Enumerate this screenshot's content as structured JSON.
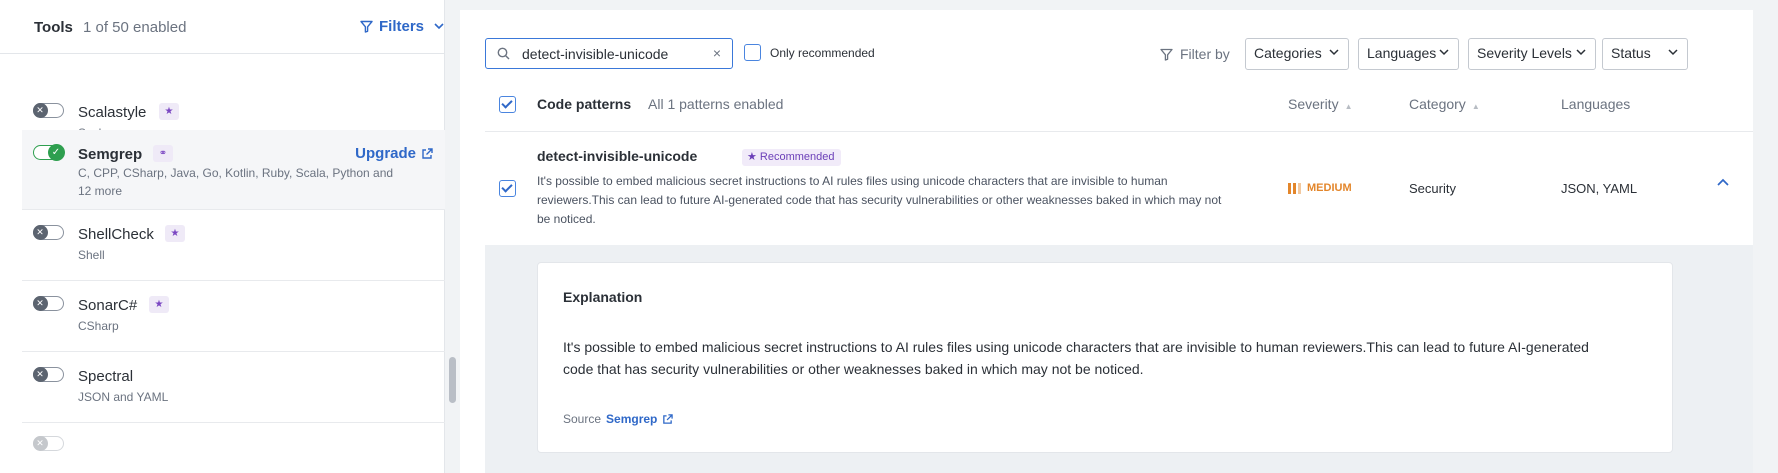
{
  "sidebar": {
    "title": "Tools",
    "enabled_count": "1 of 50 enabled",
    "filters_label": "Filters",
    "tools": [
      {
        "name": "Scalastyle",
        "languages": "Scala",
        "enabled": false,
        "recommended": true
      },
      {
        "name": "Semgrep",
        "languages": "C, CPP, CSharp, Java, Go, Kotlin, Ruby, Scala, Python and",
        "languages_more": "12 more",
        "enabled": true,
        "upgrade_label": "Upgrade"
      },
      {
        "name": "ShellCheck",
        "languages": "Shell",
        "enabled": false,
        "recommended": true
      },
      {
        "name": "SonarC#",
        "languages": "CSharp",
        "enabled": false,
        "recommended": true
      },
      {
        "name": "Spectral",
        "languages": "JSON and YAML",
        "enabled": false
      }
    ],
    "recommended_glyph": "★",
    "plugin_glyph": "⚭"
  },
  "toolbar": {
    "search_value": "detect-invisible-unicode",
    "clear_glyph": "×",
    "only_recommended_label": "Only recommended",
    "filter_by_label": "Filter by",
    "dropdowns": [
      "Categories",
      "Languages",
      "Severity Levels",
      "Status"
    ]
  },
  "table": {
    "header_title": "Code patterns",
    "header_count": "All 1 patterns enabled",
    "col_severity": "Severity",
    "col_category": "Category",
    "col_languages": "Languages",
    "sort_glyph": "▲"
  },
  "pattern": {
    "name": "detect-invisible-unicode",
    "recommended_label": "★ Recommended",
    "description": "It's possible to embed malicious secret instructions to AI rules files using unicode characters that are invisible to human reviewers.This can lead to future AI-generated code that has security vulnerabilities or other weaknesses baked in which may not be noticed.",
    "severity": "MEDIUM",
    "severity_level": 2,
    "severity_levels_total": 3,
    "category": "Security",
    "languages": "JSON, YAML",
    "checked": true
  },
  "explanation": {
    "heading": "Explanation",
    "text": "It's possible to embed malicious secret instructions to AI rules files using unicode characters that are invisible to human reviewers.This can lead to future AI-generated code that has security vulnerabilities or other weaknesses baked in which may not be noticed.",
    "source_label": "Source",
    "source_link": "Semgrep"
  },
  "colors": {
    "accent": "#2f68c8",
    "enabled_green": "#2e9f4f",
    "severity_medium": "#e3862b",
    "recommended_purple": "#7a46c2"
  }
}
